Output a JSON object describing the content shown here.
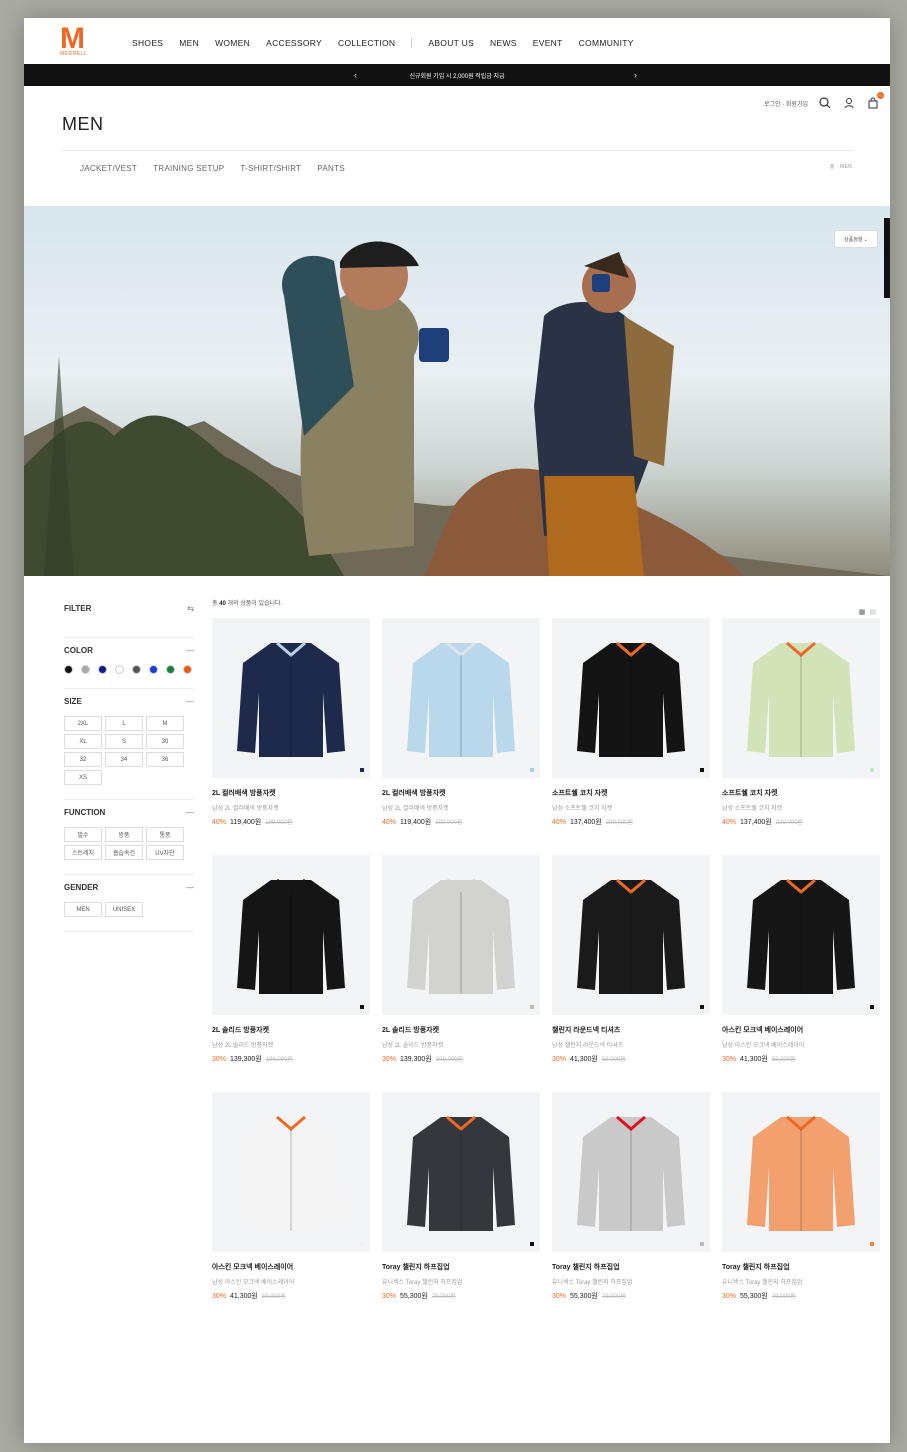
{
  "brand": {
    "logo_letter": "M",
    "logo_sub": "MERRELL",
    "accent": "#ee6a24"
  },
  "nav": {
    "items": [
      "SHOES",
      "MEN",
      "WOMEN",
      "ACCESSORY",
      "COLLECTION",
      "ABOUT US",
      "NEWS",
      "EVENT",
      "COMMUNITY"
    ]
  },
  "banner": {
    "text": "신규회원 가입 시 2,000원 적립금 지급",
    "prev": "‹",
    "next": "›"
  },
  "utility": {
    "login": "로그인 · 회원가입",
    "cart_count": "0"
  },
  "page": {
    "title": "MEN"
  },
  "subnav": {
    "items": [
      "JACKET/VEST",
      "TRAINING SETUP",
      "T-SHIRT/SHIRT",
      "PANTS"
    ],
    "breadcrumb": "홈 · MEN"
  },
  "sort": {
    "label": "상품정렬 ⌄"
  },
  "filter": {
    "title": "FILTER",
    "color": {
      "title": "COLOR",
      "swatches": [
        "#111111",
        "#aaaaaa",
        "#0a1a8a",
        "#ffffff",
        "#555555",
        "#1a3bd6",
        "#15833a",
        "#ee5a14"
      ]
    },
    "size": {
      "title": "SIZE",
      "options": [
        "2XL",
        "L",
        "M",
        "XL",
        "S",
        "30",
        "32",
        "34",
        "36",
        "XS"
      ]
    },
    "function": {
      "title": "FUNCTION",
      "options": [
        "발수",
        "방풍",
        "통풍",
        "스트레치",
        "흡습속건",
        "UV차단"
      ]
    },
    "gender": {
      "title": "GENDER",
      "options": [
        "MEN",
        "UNISEX"
      ]
    }
  },
  "result": {
    "prefix": "총 ",
    "count": "40",
    "suffix": " 개의 상품이 있습니다."
  },
  "products": [
    {
      "name": "2L 컬러배색 방풍자켓",
      "sub": "남성 2L 컬러배색 방풍자켓",
      "discount": "40%",
      "price": "119,400원",
      "original": "199,000원",
      "color": "#1d2a4b",
      "accent": "#b9d4ea",
      "dot": "#1d2a4b"
    },
    {
      "name": "2L 컬러배색 방풍자켓",
      "sub": "남성 2L 컬러배색 방풍자켓",
      "discount": "40%",
      "price": "119,400원",
      "original": "199,000원",
      "color": "#b9d8ec",
      "accent": "#dfe3e6",
      "dot": "#a7d0ea"
    },
    {
      "name": "소프트쉘 코치 자켓",
      "sub": "남성 소프트쉘 코치 자켓",
      "discount": "40%",
      "price": "137,400원",
      "original": "229,000원",
      "color": "#141414",
      "accent": "#ee6a24",
      "dot": "#111111"
    },
    {
      "name": "소프트쉘 코치 자켓",
      "sub": "남성 소프트쉘 코치 자켓",
      "discount": "40%",
      "price": "137,400원",
      "original": "229,000원",
      "color": "#d3e3b8",
      "accent": "#ee6a24",
      "dot": "#cfe6c0"
    },
    {
      "name": "2L 솔리드 방풍자켓",
      "sub": "남성 2L 솔리드 방풍자켓",
      "discount": "30%",
      "price": "139,300원",
      "original": "199,000원",
      "color": "#151515",
      "accent": "#151515",
      "dot": "#111111"
    },
    {
      "name": "2L 솔리드 방풍자켓",
      "sub": "남성 2L 솔리드 방풍자켓",
      "discount": "30%",
      "price": "139,300원",
      "original": "199,000원",
      "color": "#d2d2d0",
      "accent": "#d2d2d0",
      "dot": "#bbbbbb"
    },
    {
      "name": "챌린지 라운드넥 티셔츠",
      "sub": "남성 챌린지 라운드넥 티셔츠",
      "discount": "30%",
      "price": "41,300원",
      "original": "59,000원",
      "color": "#1a1a1a",
      "accent": "#ee6a24",
      "dot": "#111111"
    },
    {
      "name": "아스킨 모크넥 베이스레이어",
      "sub": "남성 아스킨 모크넥 베이스레이어",
      "discount": "30%",
      "price": "41,300원",
      "original": "59,000원",
      "color": "#161616",
      "accent": "#ee6a24",
      "dot": "#111111"
    },
    {
      "name": "아스킨 모크넥 베이스레이어",
      "sub": "남성 아스킨 모크넥 베이스레이어",
      "discount": "30%",
      "price": "41,300원",
      "original": "59,000원",
      "color": "#f4f4f4",
      "accent": "#ee6a24",
      "dot": "#eeeeee"
    },
    {
      "name": "Toray 챌린지 하프집업",
      "sub": "유니섹스 Toray 챌린지 하프집업",
      "discount": "30%",
      "price": "55,300원",
      "original": "79,000원",
      "color": "#34383d",
      "accent": "#ee6a24",
      "dot": "#111111"
    },
    {
      "name": "Toray 챌린지 하프집업",
      "sub": "유니섹스 Toray 챌린지 하프집업",
      "discount": "30%",
      "price": "55,300원",
      "original": "79,000원",
      "color": "#c9c9c9",
      "accent": "#d12",
      "dot": "#bbbbbb"
    },
    {
      "name": "Toray 챌린지 하프집업",
      "sub": "유니섹스 Toray 챌린지 하프집업",
      "discount": "30%",
      "price": "55,300원",
      "original": "79,000원",
      "color": "#f3a06f",
      "accent": "#ee6a24",
      "dot": "#ee8a3a"
    }
  ]
}
